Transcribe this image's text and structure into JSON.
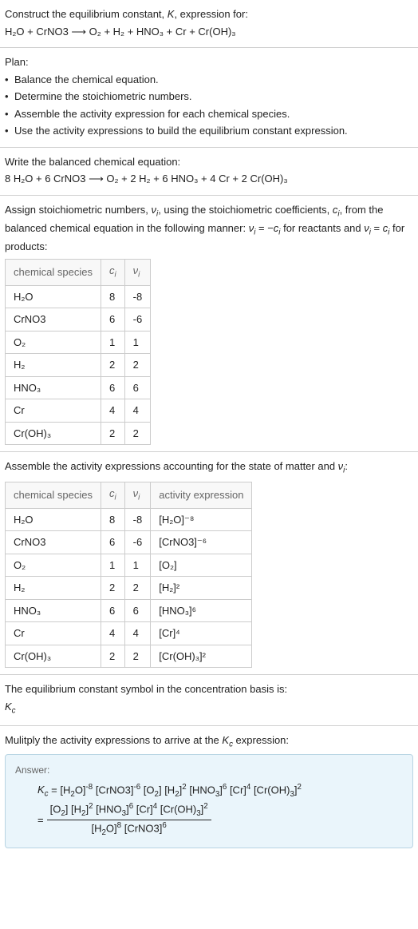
{
  "prompt": {
    "line1": "Construct the equilibrium constant, K, expression for:",
    "eq": "H₂O + CrNO3 ⟶ O₂ + H₂ + HNO₃ + Cr + Cr(OH)₃"
  },
  "plan": {
    "title": "Plan:",
    "items": [
      "Balance the chemical equation.",
      "Determine the stoichiometric numbers.",
      "Assemble the activity expression for each chemical species.",
      "Use the activity expressions to build the equilibrium constant expression."
    ]
  },
  "balanced": {
    "title": "Write the balanced chemical equation:",
    "eq": "8 H₂O + 6 CrNO3 ⟶ O₂ + 2 H₂ + 6 HNO₃ + 4 Cr + 2 Cr(OH)₃"
  },
  "stoich": {
    "intro_a": "Assign stoichiometric numbers, νᵢ, using the stoichiometric coefficients, cᵢ, from the balanced chemical equation in the following manner: νᵢ = −cᵢ for reactants and νᵢ = cᵢ for products:",
    "headers": {
      "species": "chemical species",
      "ci": "cᵢ",
      "ni": "νᵢ"
    },
    "rows": [
      {
        "species": "H₂O",
        "ci": "8",
        "ni": "-8"
      },
      {
        "species": "CrNO3",
        "ci": "6",
        "ni": "-6"
      },
      {
        "species": "O₂",
        "ci": "1",
        "ni": "1"
      },
      {
        "species": "H₂",
        "ci": "2",
        "ni": "2"
      },
      {
        "species": "HNO₃",
        "ci": "6",
        "ni": "6"
      },
      {
        "species": "Cr",
        "ci": "4",
        "ni": "4"
      },
      {
        "species": "Cr(OH)₃",
        "ci": "2",
        "ni": "2"
      }
    ]
  },
  "activity": {
    "intro": "Assemble the activity expressions accounting for the state of matter and νᵢ:",
    "headers": {
      "species": "chemical species",
      "ci": "cᵢ",
      "ni": "νᵢ",
      "expr": "activity expression"
    },
    "rows": [
      {
        "species": "H₂O",
        "ci": "8",
        "ni": "-8",
        "expr": "[H₂O]⁻⁸"
      },
      {
        "species": "CrNO3",
        "ci": "6",
        "ni": "-6",
        "expr": "[CrNO3]⁻⁶"
      },
      {
        "species": "O₂",
        "ci": "1",
        "ni": "1",
        "expr": "[O₂]"
      },
      {
        "species": "H₂",
        "ci": "2",
        "ni": "2",
        "expr": "[H₂]²"
      },
      {
        "species": "HNO₃",
        "ci": "6",
        "ni": "6",
        "expr": "[HNO₃]⁶"
      },
      {
        "species": "Cr",
        "ci": "4",
        "ni": "4",
        "expr": "[Cr]⁴"
      },
      {
        "species": "Cr(OH)₃",
        "ci": "2",
        "ni": "2",
        "expr": "[Cr(OH)₃]²"
      }
    ]
  },
  "symbol": {
    "line1": "The equilibrium constant symbol in the concentration basis is:",
    "line2": "K꜀"
  },
  "multiply": {
    "title": "Mulitply the activity expressions to arrive at the K꜀ expression:"
  },
  "answer": {
    "label": "Answer:",
    "flat": "K꜀ = [H₂O]⁻⁸ [CrNO3]⁻⁶ [O₂] [H₂]² [HNO₃]⁶ [Cr]⁴ [Cr(OH)₃]²",
    "num": "[O₂] [H₂]² [HNO₃]⁶ [Cr]⁴ [Cr(OH)₃]²",
    "den": "[H₂O]⁸ [CrNO3]⁶",
    "eq": "="
  }
}
